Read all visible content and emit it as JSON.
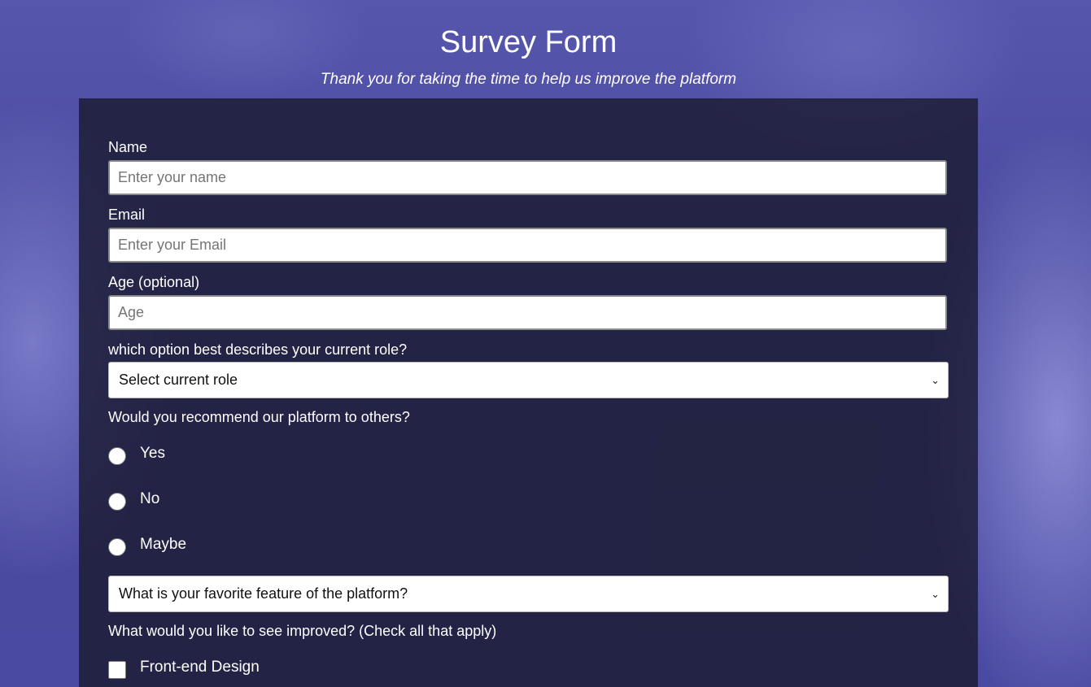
{
  "header": {
    "title": "Survey Form",
    "description": "Thank you for taking the time to help us improve the platform"
  },
  "form": {
    "name": {
      "label": "Name",
      "placeholder": "Enter your name"
    },
    "email": {
      "label": "Email",
      "placeholder": "Enter your Email"
    },
    "age": {
      "label": "Age (optional)",
      "placeholder": "Age"
    },
    "role": {
      "label": "which option best describes your current role?",
      "selected": "Select current role"
    },
    "recommend": {
      "label": "Would you recommend our platform to others?",
      "options": [
        "Yes",
        "No",
        "Maybe"
      ]
    },
    "favorite": {
      "selected": "What is your favorite feature of the platform?"
    },
    "improve": {
      "label": "What would you like to see improved? (Check all that apply)",
      "options": [
        "Front-end Design"
      ]
    }
  },
  "icons": {
    "select_chevron": "chevron-down-icon"
  }
}
